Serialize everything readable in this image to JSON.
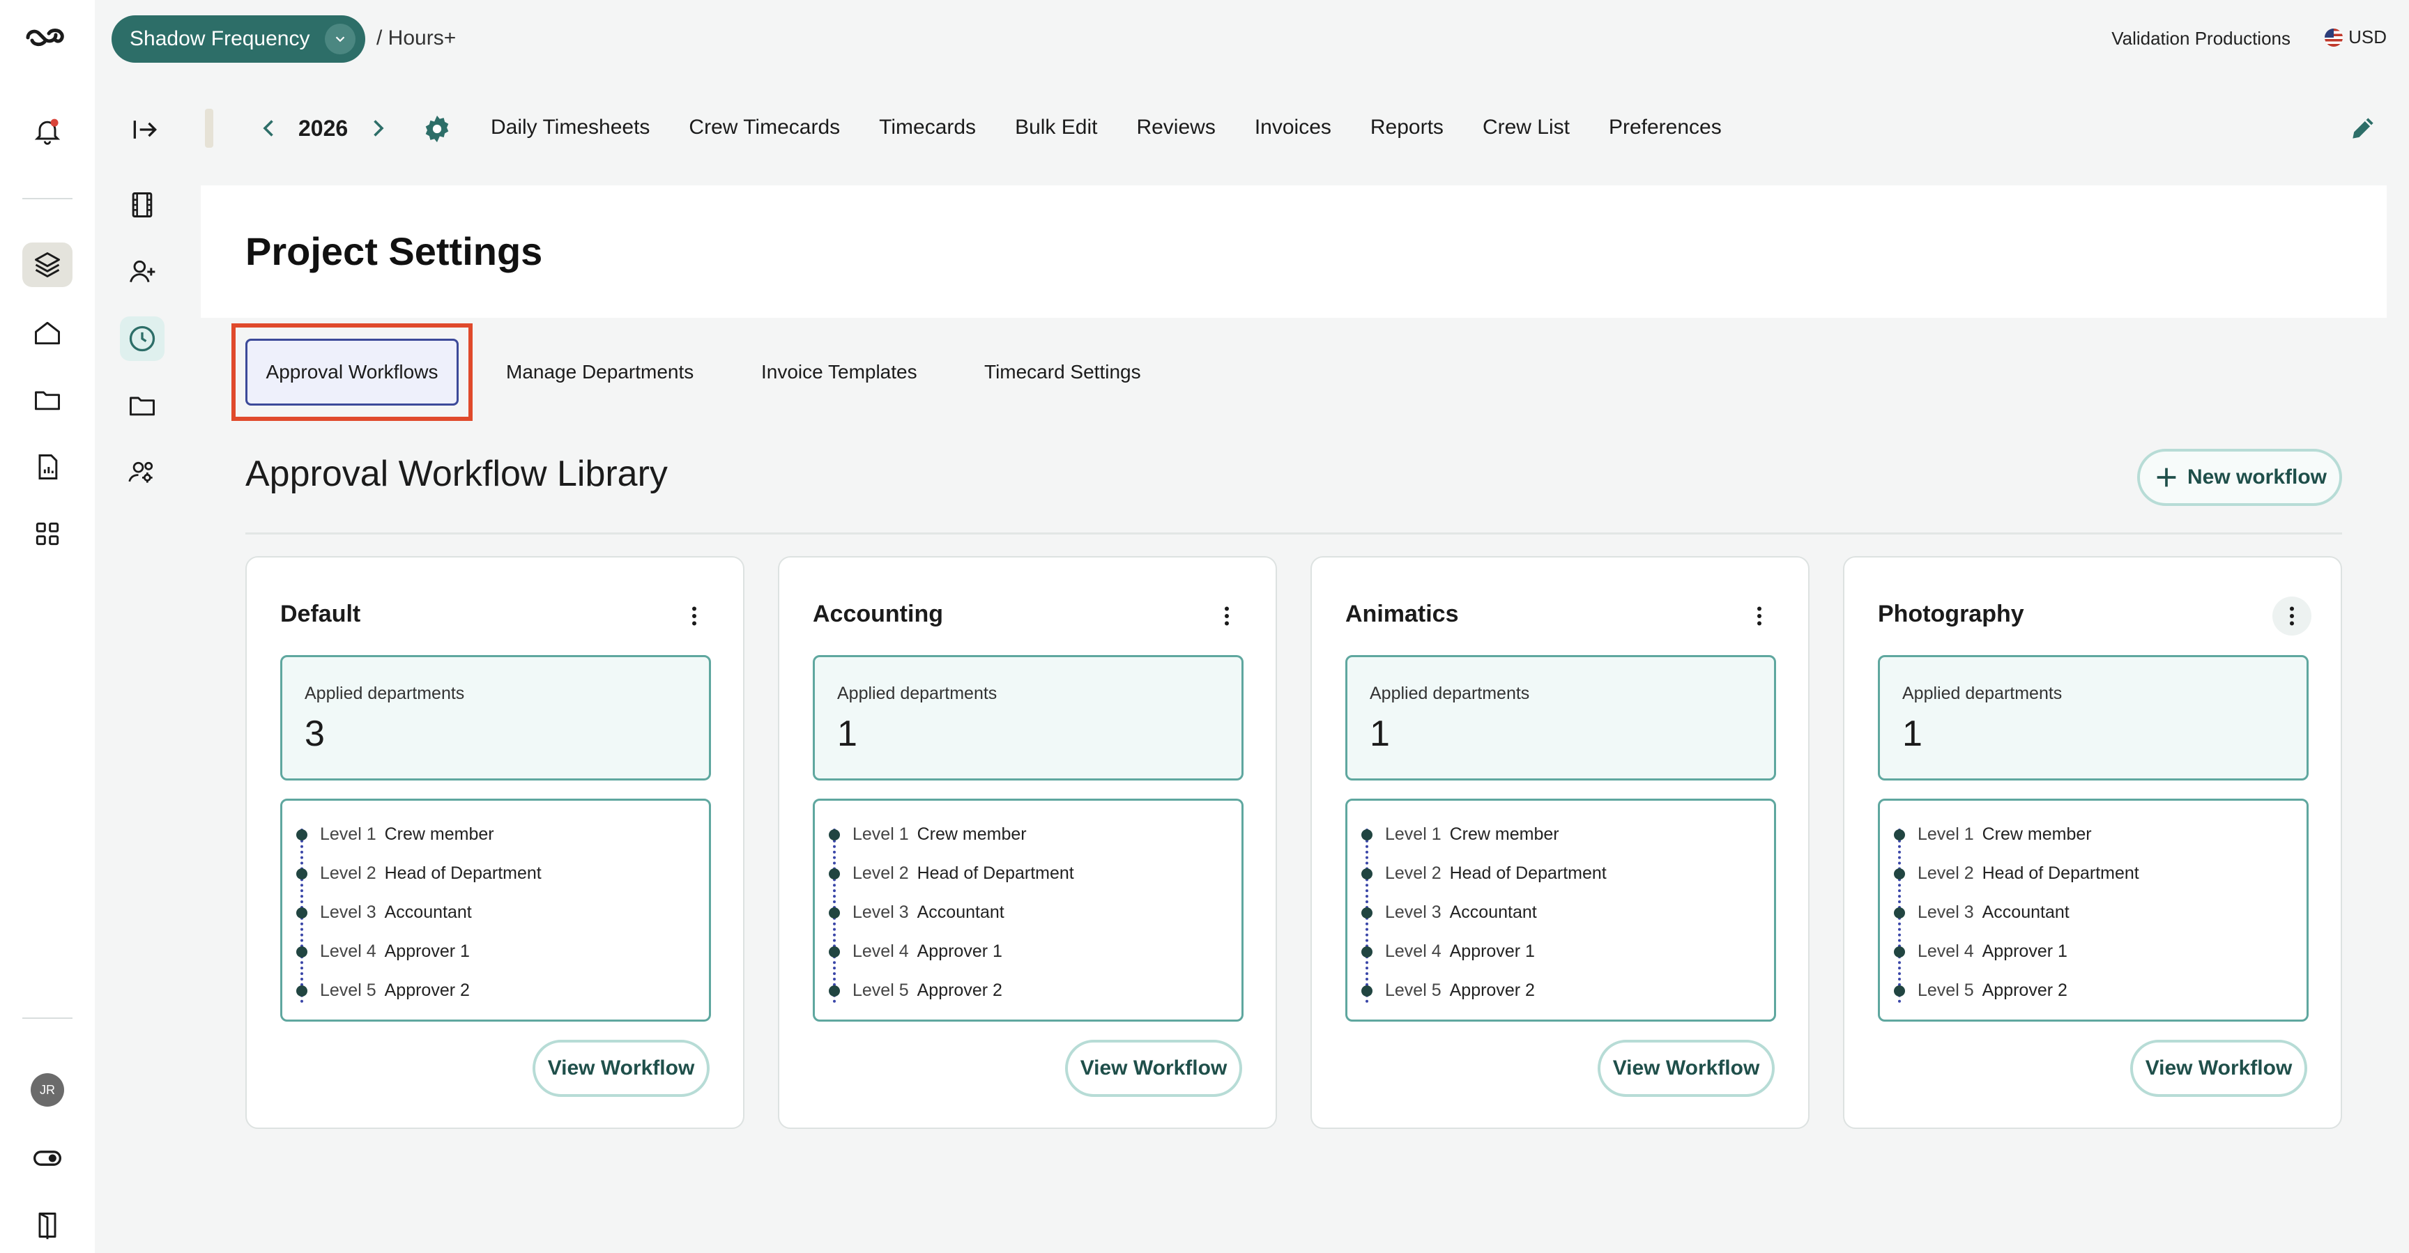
{
  "topbar": {
    "project": "Shadow Frequency",
    "breadcrumb": "/ Hours+",
    "company": "Validation Productions",
    "currency": "USD",
    "user_initials": "JR"
  },
  "nav": {
    "year": "2026",
    "items": [
      "Daily Timesheets",
      "Crew Timecards",
      "Timecards",
      "Bulk Edit",
      "Reviews",
      "Invoices",
      "Reports",
      "Crew List",
      "Preferences"
    ]
  },
  "page": {
    "title": "Project Settings",
    "tabs": [
      "Approval Workflows",
      "Manage Departments",
      "Invoice Templates",
      "Timecard Settings"
    ],
    "active_tab": "Approval Workflows"
  },
  "library": {
    "title": "Approval Workflow Library",
    "new_button": "New workflow",
    "applied_label": "Applied departments",
    "view_label": "View Workflow",
    "workflows": [
      {
        "name": "Default",
        "applied": "3",
        "levels": [
          {
            "level": "Level 1",
            "role": "Crew member"
          },
          {
            "level": "Level 2",
            "role": "Head of Department"
          },
          {
            "level": "Level 3",
            "role": "Accountant"
          },
          {
            "level": "Level 4",
            "role": "Approver 1"
          },
          {
            "level": "Level 5",
            "role": "Approver 2"
          }
        ]
      },
      {
        "name": "Accounting",
        "applied": "1",
        "levels": [
          {
            "level": "Level 1",
            "role": "Crew member"
          },
          {
            "level": "Level 2",
            "role": "Head of Department"
          },
          {
            "level": "Level 3",
            "role": "Accountant"
          },
          {
            "level": "Level 4",
            "role": "Approver 1"
          },
          {
            "level": "Level 5",
            "role": "Approver 2"
          }
        ]
      },
      {
        "name": "Animatics",
        "applied": "1",
        "levels": [
          {
            "level": "Level 1",
            "role": "Crew member"
          },
          {
            "level": "Level 2",
            "role": "Head of Department"
          },
          {
            "level": "Level 3",
            "role": "Accountant"
          },
          {
            "level": "Level 4",
            "role": "Approver 1"
          },
          {
            "level": "Level 5",
            "role": "Approver 2"
          }
        ]
      },
      {
        "name": "Photography",
        "applied": "1",
        "levels": [
          {
            "level": "Level 1",
            "role": "Crew member"
          },
          {
            "level": "Level 2",
            "role": "Head of Department"
          },
          {
            "level": "Level 3",
            "role": "Accountant"
          },
          {
            "level": "Level 4",
            "role": "Approver 1"
          },
          {
            "level": "Level 5",
            "role": "Approver 2"
          }
        ]
      }
    ]
  },
  "colors": {
    "accent": "#2d6e68",
    "highlight_border": "#e04a2c",
    "card_border": "#5fa79f"
  }
}
